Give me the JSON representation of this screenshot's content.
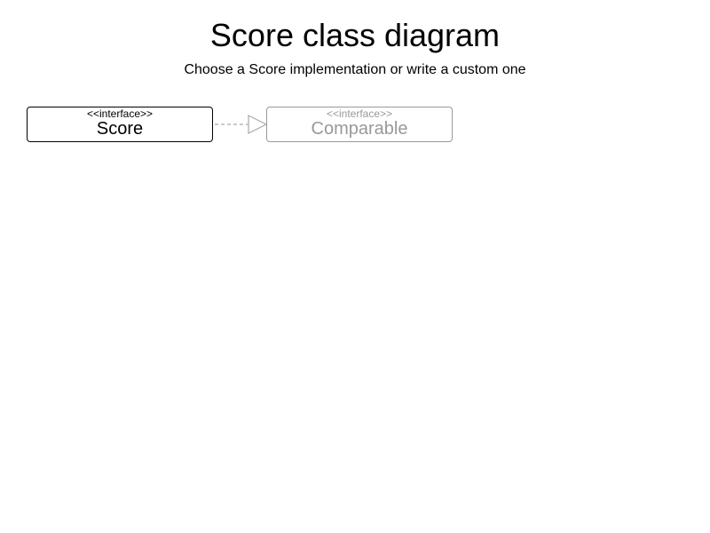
{
  "diagram": {
    "title": "Score class diagram",
    "subtitle": "Choose a Score implementation or write a custom one",
    "classes": [
      {
        "stereotype": "<<interface>>",
        "name": "Score"
      },
      {
        "stereotype": "<<interface>>",
        "name": "Comparable"
      }
    ],
    "relationship": {
      "type": "realization",
      "from": "Score",
      "to": "Comparable",
      "line_style": "dashed",
      "arrowhead": "hollow-triangle"
    },
    "colors": {
      "primary_stroke": "#000000",
      "secondary_stroke": "#999999",
      "connector_stroke": "#aaaaaa"
    }
  }
}
